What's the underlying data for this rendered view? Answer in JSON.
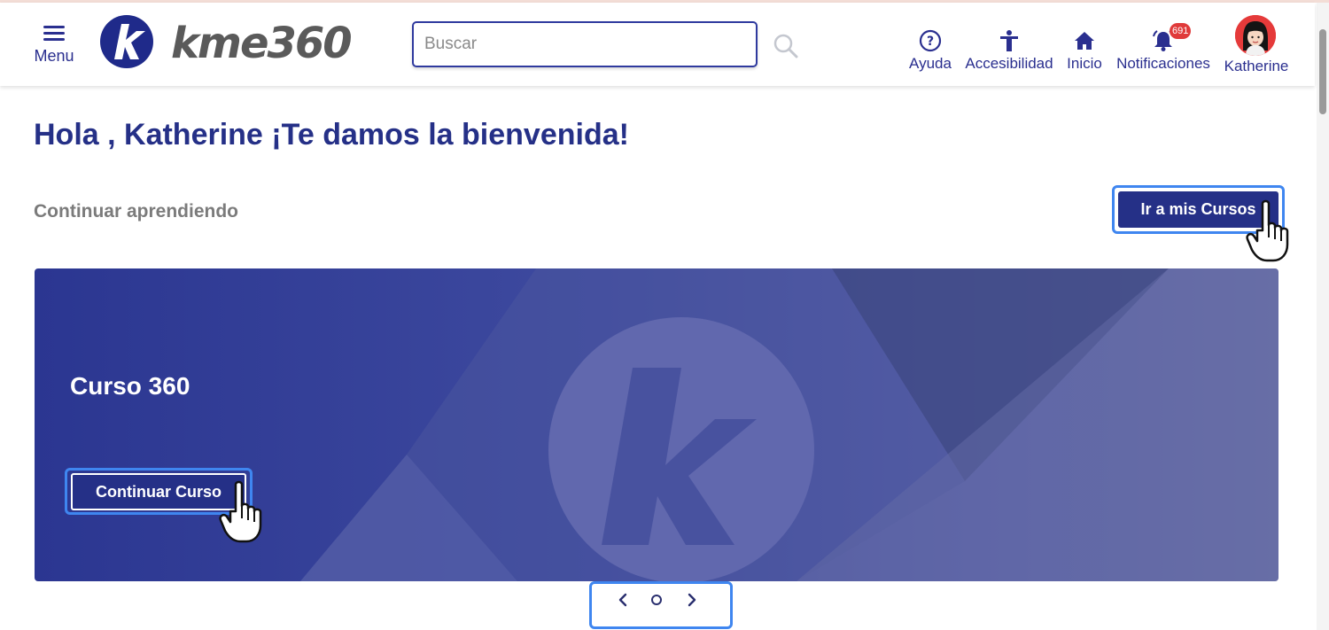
{
  "header": {
    "menu_label": "Menu",
    "logo_text": "kme360",
    "search_placeholder": "Buscar",
    "nav": {
      "help": "Ayuda",
      "accessibility": "Accesibilidad",
      "home": "Inicio",
      "notifications": "Notificaciones",
      "notifications_count": "691",
      "user": "Katherine"
    }
  },
  "main": {
    "greeting": "Hola , Katherine ¡Te damos la bienvenida!",
    "continue_label": "Continuar aprendiendo",
    "courses_button": "Ir a mis Cursos",
    "banner": {
      "course_title": "Curso 360",
      "continue_button": "Continuar Curso"
    }
  },
  "colors": {
    "brand": "#253087",
    "highlight": "#3f86f0",
    "badge": "#e03b3b"
  },
  "icons": {
    "menu": "hamburger-icon",
    "search": "magnifier-icon",
    "help": "question-circle-icon",
    "accessibility": "accessibility-person-icon",
    "home": "house-icon",
    "notifications": "bell-icon",
    "pager_prev": "chevron-left-icon",
    "pager_next": "chevron-right-icon"
  }
}
